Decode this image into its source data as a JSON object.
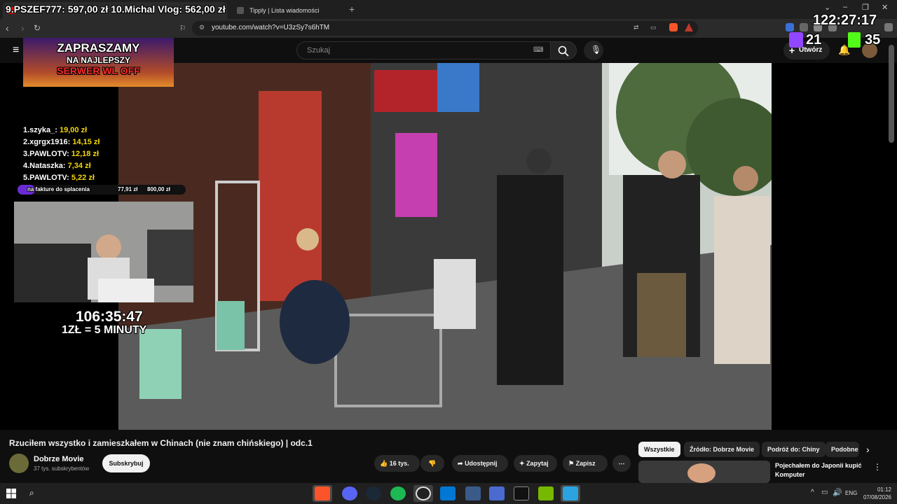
{
  "browser": {
    "tabs": [
      {
        "label": "9.PSZEF777: 597,00 zł 10.Michal Vlog: 562,00 zł",
        "active": true
      },
      {
        "label": "Tipply | Lista wiadomości",
        "active": false
      }
    ],
    "url": "youtube.com/watch?v=U3zSy7s6hTM"
  },
  "youtube": {
    "search_placeholder": "Szukaj",
    "create_label": "Utwórz",
    "video_title": "Rzuciłem wszystko i zamieszkałem w Chinach (nie znam chińskiego) | odc.1",
    "channel_name": "Dobrze Movie",
    "channel_subs": "37 tys. subskrybentów",
    "subscribe_label": "Subskrybuj",
    "likes": "16 tys.",
    "share_label": "Udostępnij",
    "ask_label": "Zapytaj",
    "save_label": "Zapisz",
    "chips": [
      "Wszystkie",
      "Źródło: Dobrze Movie",
      "Podróż do: Chiny",
      "Podobne"
    ],
    "recommended_title": "Pojechałem do Japonii kupić Komputer"
  },
  "overlay": {
    "top_donors": "9.PSZEF777: 597,00 zł 10.Michal Vlog: 562,00 zł",
    "clock": "122:27:17",
    "banner_line1": "ZAPRASZAMY",
    "banner_line2": "NA NAJLEPSZY",
    "banner_line3": "SERWER WL OFF",
    "leaderboard": [
      {
        "name": "1.szyka_:",
        "amount": "19,00 zł"
      },
      {
        "name": "2.xgrgx1916:",
        "amount": "14,15 zł"
      },
      {
        "name": "3.PAWLOTV:",
        "amount": "12,18 zł"
      },
      {
        "name": "4.Nataszka:",
        "amount": "7,34 zł"
      },
      {
        "name": "5.PAWLOTV:",
        "amount": "5,22 zł"
      }
    ],
    "goal_label": "na fakture do splacenia",
    "goal_current": "77,91 zł",
    "goal_target": "800,00 zł",
    "timer": "106:35:47",
    "rate": "1ZŁ = 5 MINUTY",
    "twitch_viewers": "21",
    "kick_viewers": "35"
  },
  "taskbar": {
    "lang": "ENG",
    "time": "01:12",
    "date": "07/08/2026"
  },
  "colors": {
    "accent_yellow": "#f5d60a",
    "kick_green": "#53fc18",
    "twitch_purple": "#9146ff"
  }
}
